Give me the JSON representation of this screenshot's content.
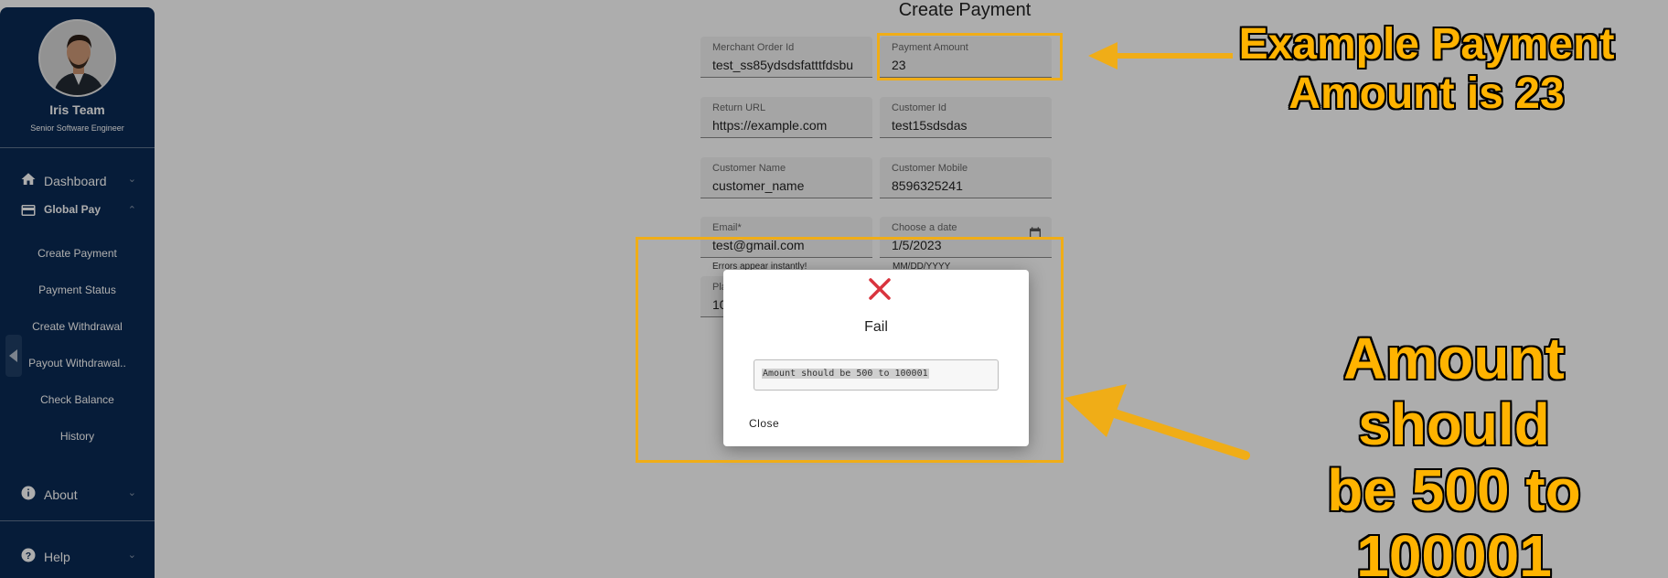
{
  "sidebar": {
    "user": {
      "name": "Iris Team",
      "role": "Senior Software Engineer"
    },
    "nav": [
      {
        "label": "Dashboard",
        "icon": "home-icon"
      },
      {
        "label": "Global Pay",
        "icon": "credit-card-icon"
      }
    ],
    "sub_items": [
      "Create Payment",
      "Payment Status",
      "Create Withdrawal",
      "Payout Withdrawal..",
      "Check Balance",
      "History"
    ],
    "about": {
      "label": "About",
      "icon": "info-icon"
    },
    "help": {
      "label": "Help",
      "icon": "help-icon"
    }
  },
  "form": {
    "title": "Create Payment",
    "fields": {
      "merchant_order_id": {
        "label": "Merchant Order Id",
        "value": "test_ss85ydsdsfatttfdsbu"
      },
      "payment_amount": {
        "label": "Payment Amount",
        "value": "23"
      },
      "return_url": {
        "label": "Return URL",
        "value": "https://example.com"
      },
      "customer_id": {
        "label": "Customer Id",
        "value": "test15sdsdas"
      },
      "customer_name": {
        "label": "Customer Name",
        "value": "customer_name"
      },
      "customer_mobile": {
        "label": "Customer Mobile",
        "value": "8596325241"
      },
      "email": {
        "label": "Email*",
        "value": "test@gmail.com",
        "hint": "Errors appear instantly!"
      },
      "date": {
        "label": "Choose a date",
        "value": "1/5/2023",
        "hint": "MM/DD/YYYY"
      },
      "partial": {
        "label": "Pla",
        "value": "10"
      }
    }
  },
  "dialog": {
    "title": "Fail",
    "message": "Amount should be 500 to 100001",
    "close_label": "Close",
    "icon": "close-x-icon"
  },
  "annotations": {
    "top": "Example Payment Amount is 23",
    "top_lines": [
      "Example Payment",
      "Amount is 23"
    ],
    "bottom": "Amount should be 500 to 100001",
    "bottom_lines": [
      "Amount should",
      "be 500 to",
      "100001"
    ]
  },
  "colors": {
    "sidebar_bg": "#0a2a54",
    "annotation": "#f0ad17",
    "fail_icon": "#d9343e"
  }
}
